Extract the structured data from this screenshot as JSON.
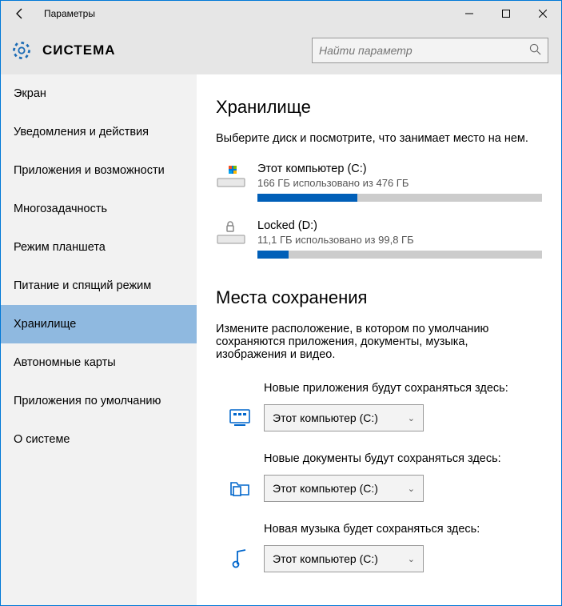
{
  "window": {
    "title": "Параметры"
  },
  "header": {
    "section": "СИСТЕМА",
    "search_placeholder": "Найти параметр"
  },
  "sidebar": {
    "items": [
      {
        "label": "Экран"
      },
      {
        "label": "Уведомления и действия"
      },
      {
        "label": "Приложения и возможности"
      },
      {
        "label": "Многозадачность"
      },
      {
        "label": "Режим планшета"
      },
      {
        "label": "Питание и спящий режим"
      },
      {
        "label": "Хранилище"
      },
      {
        "label": "Автономные карты"
      },
      {
        "label": "Приложения по умолчанию"
      },
      {
        "label": "О системе"
      }
    ],
    "active_index": 6
  },
  "storage": {
    "heading": "Хранилище",
    "desc": "Выберите диск и посмотрите, что занимает место на нем.",
    "drives": [
      {
        "name": "Этот компьютер (C:)",
        "usage_text": "166 ГБ использовано из 476 ГБ",
        "fill_percent": 35
      },
      {
        "name": "Locked (D:)",
        "usage_text": "11,1 ГБ использовано из 99,8 ГБ",
        "fill_percent": 11
      }
    ]
  },
  "save_locations": {
    "heading": "Места сохранения",
    "desc": "Измените расположение, в котором по умолчанию сохраняются приложения, документы, музыка, изображения и видео.",
    "items": [
      {
        "label": "Новые приложения будут сохраняться здесь:",
        "value": "Этот компьютер (C:)"
      },
      {
        "label": "Новые документы будут сохраняться здесь:",
        "value": "Этот компьютер (C:)"
      },
      {
        "label": "Новая музыка будет сохраняться здесь:",
        "value": "Этот компьютер (C:)"
      }
    ]
  }
}
